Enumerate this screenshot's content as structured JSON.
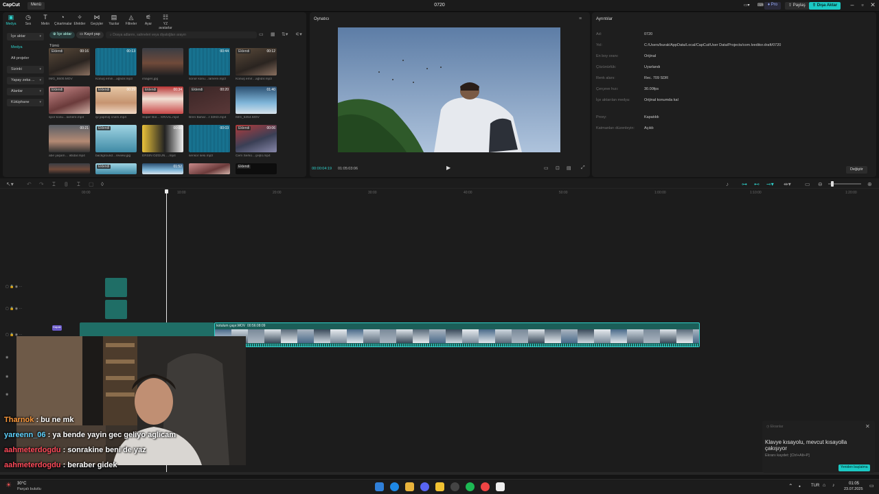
{
  "app": {
    "logo": "CapCut",
    "menu_label": "Menü",
    "project_title": "0720",
    "pro_label": "Pro",
    "share_label": "Paylaş",
    "export_label": "Dışa Aktar",
    "accent_color": "#1bc9c4"
  },
  "toolbar": {
    "tools": [
      {
        "label": "Medya",
        "icon": "media-icon",
        "glyph": "▣"
      },
      {
        "label": "Ses",
        "icon": "audio-icon",
        "glyph": "◷"
      },
      {
        "label": "Metin",
        "icon": "text-icon",
        "glyph": "T"
      },
      {
        "label": "Çıkartmalar",
        "icon": "sticker-icon",
        "glyph": "◔"
      },
      {
        "label": "Efektler",
        "icon": "effects-icon",
        "glyph": "✧"
      },
      {
        "label": "Geçişler",
        "icon": "transition-icon",
        "glyph": "⋈"
      },
      {
        "label": "Yazılar",
        "icon": "captions-icon",
        "glyph": "▤"
      },
      {
        "label": "Filtreler",
        "icon": "filter-icon",
        "glyph": "◬"
      },
      {
        "label": "Ayar",
        "icon": "adjust-icon",
        "glyph": "⚟"
      },
      {
        "label": "YZ avatarlar",
        "icon": "ai-avatar-icon",
        "glyph": "☷"
      }
    ]
  },
  "sidebar": {
    "items": [
      {
        "label": "İçe aktar",
        "chevron": true
      },
      {
        "label": "Medya",
        "chevron": false
      },
      {
        "label": "Alt projeler",
        "chevron": false
      },
      {
        "label": "Sizinki",
        "chevron": true
      },
      {
        "label": "Yapay zeka ...",
        "chevron": true
      },
      {
        "label": "Alanlar",
        "chevron": true
      },
      {
        "label": "Kütüphane",
        "chevron": true
      }
    ]
  },
  "media": {
    "import_label": "İçe aktar",
    "record_label": "Kayıt yap",
    "search_placeholder": "Dosya adlarını, sahneleri veya diyaloğları arayın",
    "section_label": "Tümü",
    "added_badge": "Eklendi",
    "items": [
      {
        "name": "IMG_5500.MOV",
        "duration": "00:16",
        "badge": true,
        "kind": "room"
      },
      {
        "name": "Konuş emin…ağlıdır.mp3",
        "duration": "00:13",
        "badge": false,
        "kind": "audio"
      },
      {
        "name": "images.jpg",
        "duration": "",
        "badge": false,
        "kind": "person"
      },
      {
        "name": "sonor konu…lamere.mp3",
        "duration": "00:44",
        "badge": false,
        "kind": "audio"
      },
      {
        "name": "Konuş emir…ağlıdır.mp3",
        "duration": "00:12",
        "badge": true,
        "kind": "room"
      },
      {
        "name": "spor konu…lamere.mp4",
        "duration": "",
        "badge": true,
        "kind": "pink"
      },
      {
        "name": "iyi yapmış cnem.mp4",
        "duration": "00:29",
        "badge": true,
        "kind": "blonde"
      },
      {
        "name": "Süper Bol… KRAAL.mp4",
        "duration": "00:34",
        "badge": true,
        "kind": "studio"
      },
      {
        "name": "Bren Bahar…t 32KD.mp4",
        "duration": "00:20",
        "badge": true,
        "kind": "dark"
      },
      {
        "name": "IMG_5354.MOV",
        "duration": "01:40",
        "badge": false,
        "kind": "blue"
      },
      {
        "name": "abe yaşam… iktidar.mp4",
        "duration": "00:21",
        "badge": false,
        "kind": "person2"
      },
      {
        "name": "background…review.jpg",
        "duration": "",
        "badge": true,
        "kind": "teal"
      },
      {
        "name": "ERSIN ÖZGÜN….mp4",
        "duration": "00:06",
        "badge": false,
        "kind": "yellow"
      },
      {
        "name": "sensor sesi.mp3",
        "duration": "00:03",
        "badge": false,
        "kind": "audio"
      },
      {
        "name": "Cem Serko…çeşlo.mp4",
        "duration": "00:06",
        "badge": true,
        "kind": "crowd"
      },
      {
        "name": "",
        "duration": "",
        "badge": false,
        "kind": "person"
      },
      {
        "name": "",
        "duration": "",
        "badge": true,
        "kind": "teal"
      },
      {
        "name": "",
        "duration": "01:52",
        "badge": false,
        "kind": "blue"
      },
      {
        "name": "",
        "duration": "",
        "badge": false,
        "kind": "pink"
      },
      {
        "name": "",
        "duration": "",
        "badge": true,
        "kind": "black"
      }
    ]
  },
  "player": {
    "title": "Oynatıcı",
    "current_time": "00:00:04:19",
    "total_time": "01:05:03:06"
  },
  "details": {
    "title": "Ayrıntılar",
    "rows": [
      {
        "key": "Ad:",
        "value": "0720"
      },
      {
        "key": "Yol:",
        "value": "C:/Users/burak/AppData/Local/CapCut/User Data/Projects/com.lveditor.draft/0720"
      },
      {
        "key": "En boy oranı:",
        "value": "Orijinal"
      },
      {
        "key": "Çözünürlük:",
        "value": "Uyarlandı"
      },
      {
        "key": "Renk alanı:",
        "value": "Rec. 709 SDR"
      },
      {
        "key": "Çerçeve hızı:",
        "value": "30.00fps"
      },
      {
        "key": "İçe aktarılan medya:",
        "value": "Orijinal konumda kal"
      },
      {
        "key": "Proxy:",
        "value": "Kapatıldı"
      },
      {
        "key": "Katmanları düzenleyin:",
        "value": "Açıldı"
      }
    ],
    "change_button": "Değiştir"
  },
  "timeline": {
    "ruler": [
      "00:00",
      "10:00",
      "20:00",
      "30:00",
      "40:00",
      "50:00",
      "1:00:00",
      "1:10:00",
      "1:20:00"
    ],
    "main_clip_label": "kotulum çaşır.MOV",
    "main_clip_duration": "00:56:08:09",
    "cover_label": "Kapak"
  },
  "stream": {
    "chat": [
      {
        "user": "Tharnok",
        "color": "#ff9a3c",
        "message": " : bu ne mk"
      },
      {
        "user": "yareenn_06",
        "color": "#5fd3ff",
        "message": " : ya bende yayin gec geliyo aglicam"
      },
      {
        "user": "aahmeterdogdu",
        "color": "#ff4a5a",
        "message": " : sonrakine beni de yaz"
      },
      {
        "user": "aahmeterdogdu",
        "color": "#ff4a5a",
        "message": " : beraber gidek"
      }
    ]
  },
  "toast": {
    "header": "Ekranlar",
    "title": "Klavye kısayolu, mevcut kısayolla çakışıyor",
    "subtitle": "Ekranı kaydet: [Ctrl+Alt+P]",
    "button": "Yeniden başlatma"
  },
  "taskbar": {
    "weather_temp": "30°C",
    "weather_desc": "Parçalı bulutlu",
    "language": "TUR",
    "time": "01:05",
    "date": "23.07.2025"
  }
}
